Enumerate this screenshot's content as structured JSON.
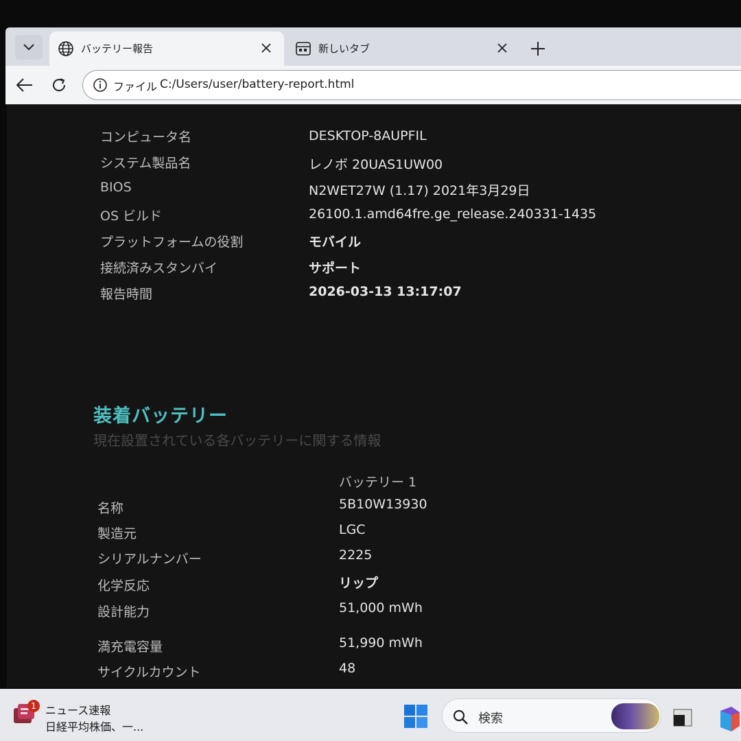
{
  "browser": {
    "tabs": [
      {
        "title": "バッテリー報告",
        "icon": "globe-icon",
        "active": true
      },
      {
        "title": "新しいタブ",
        "icon": "new-tab-page-icon",
        "active": false
      }
    ],
    "address": {
      "scheme_label": "ファイル",
      "url": "C:/Users/user/battery-report.html"
    }
  },
  "system_info": [
    {
      "label": "コンピュータ名",
      "value": "DESKTOP-8AUPFIL"
    },
    {
      "label": "システム製品名",
      "value": "レノボ 20UAS1UW00"
    },
    {
      "label": "BIOS",
      "value": "N2WET27W (1.17) 2021年3月29日"
    },
    {
      "label": "OS ビルド",
      "value": "26100.1.amd64fre.ge_release.240331-1435"
    },
    {
      "label": "プラットフォームの役割",
      "value": "モバイル"
    },
    {
      "label": "接続済みスタンバイ",
      "value": "サポート"
    },
    {
      "label": "報告時間",
      "value": "2026-03-13  13:17:07"
    }
  ],
  "battery_section": {
    "title": "装着バッテリー",
    "subtitle": "現在設置されている各バッテリーに関する情報",
    "column_header": "バッテリー 1",
    "rows": [
      {
        "label": "名称",
        "value": "5B10W13930"
      },
      {
        "label": "製造元",
        "value": "LGC"
      },
      {
        "label": "シリアルナンバー",
        "value": "2225"
      },
      {
        "label": "化学反応",
        "value": "リップ"
      },
      {
        "label": "設計能力",
        "value": "51,000 mWh"
      },
      {
        "label": "満充電容量",
        "value": "51,990 mWh"
      },
      {
        "label": "サイクルカウント",
        "value": "48"
      }
    ]
  },
  "taskbar": {
    "news_badge": "1",
    "news_title": "ニュース速報",
    "news_text": "日経平均株価、一...",
    "search_label": "検索"
  }
}
